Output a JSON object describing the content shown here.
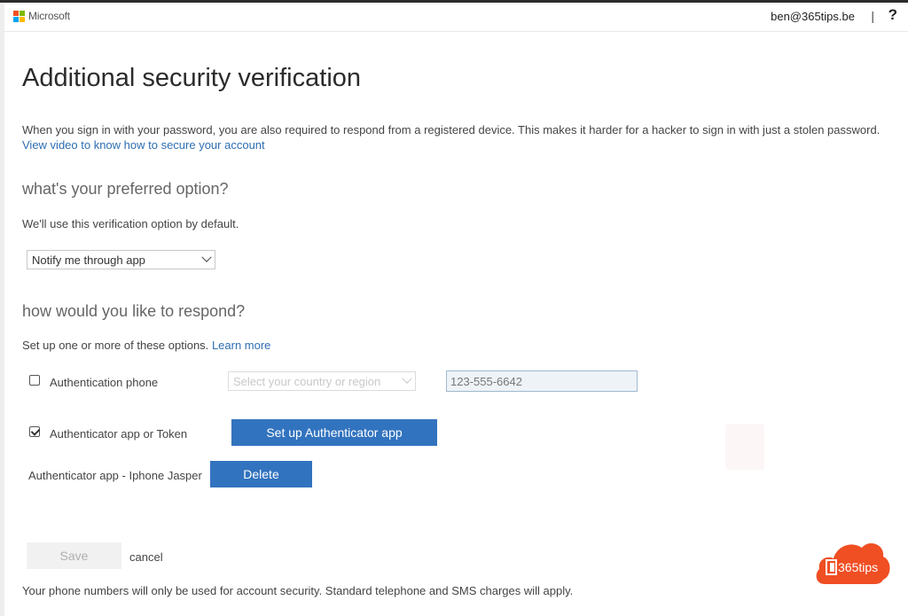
{
  "header": {
    "brand": "Microsoft",
    "user_email": "ben@365tips.be",
    "separator": "|",
    "help_icon": "?"
  },
  "page": {
    "title": "Additional security verification",
    "intro": "When you sign in with your password, you are also required to respond from a registered device. This makes it harder for a hacker to sign in with just a stolen password.",
    "video_link": "View video to know how to secure your account"
  },
  "preferred": {
    "heading": "what's your preferred option?",
    "desc": "We'll use this verification option by default.",
    "selected": "Notify me through app"
  },
  "respond": {
    "heading": "how would you like to respond?",
    "desc": "Set up one or more of these options.",
    "learn_more": "Learn more",
    "phone_label": "Authentication phone",
    "phone_checked": false,
    "country_placeholder": "Select your country or region",
    "phone_value": "123-555-6642",
    "app_label": "Authenticator app or Token",
    "app_checked": true,
    "setup_button": "Set up Authenticator app",
    "device_label": "Authenticator app - Iphone Jasper",
    "delete_button": "Delete"
  },
  "footer": {
    "save": "Save",
    "cancel": "cancel",
    "note": "Your phone numbers will only be used for account security. Standard telephone and SMS charges will apply."
  },
  "watermark": {
    "text": "365tips"
  },
  "colors": {
    "accent": "#3273bf",
    "link": "#2f6eb1",
    "badge": "#f04e23"
  }
}
